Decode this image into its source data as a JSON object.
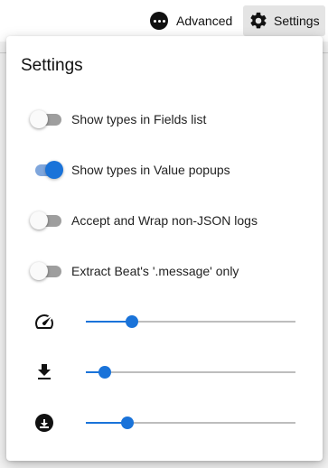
{
  "header": {
    "advanced_label": "Advanced",
    "settings_label": "Settings"
  },
  "settings": {
    "title": "Settings",
    "toggles": [
      {
        "label": "Show types in Fields list",
        "checked": false
      },
      {
        "label": "Show types in Value popups",
        "checked": true
      },
      {
        "label": "Accept and Wrap non-JSON logs",
        "checked": false
      },
      {
        "label": "Extract Beat's '.message' only",
        "checked": false
      }
    ],
    "sliders": [
      {
        "icon": "speedometer-icon",
        "value_fraction": 0.22
      },
      {
        "icon": "download-icon",
        "value_fraction": 0.09
      },
      {
        "icon": "download-circle-icon",
        "value_fraction": 0.2
      }
    ]
  },
  "colors": {
    "accent": "#1a73d9",
    "accent_track": "#7fa6dc"
  }
}
